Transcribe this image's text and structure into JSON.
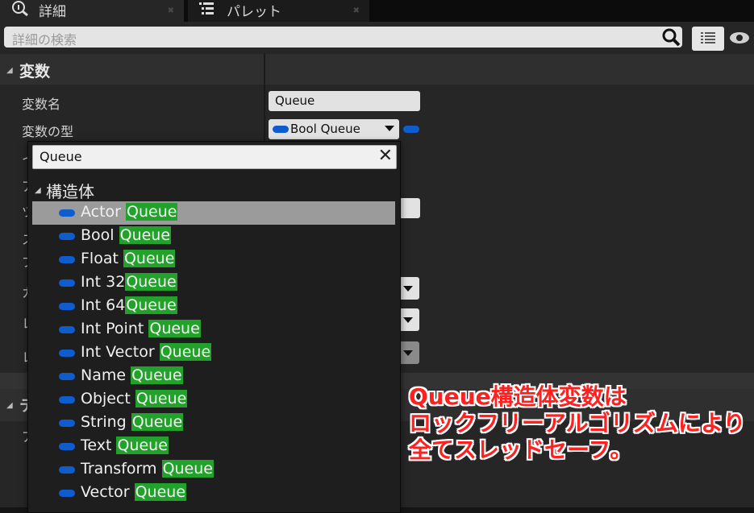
{
  "tabs": [
    {
      "label": "詳細",
      "icon": "details-icon",
      "close": "✖"
    },
    {
      "label": "パレット",
      "icon": "palette-list-icon",
      "close": "✖"
    }
  ],
  "search": {
    "placeholder": "詳細の検索",
    "icon": "search-icon"
  },
  "toolbar": {
    "view_options_icon": "grid-view-icon",
    "visibility_icon": "eye-icon"
  },
  "category": {
    "title": "変数"
  },
  "properties": {
    "name_label": "変数名",
    "name_value": "Queue",
    "type_label": "変数の型",
    "type_value": "Bool Queue"
  },
  "partial_labels": [
    "イ",
    "ア",
    "ツ",
    "ス",
    "ブ",
    "カ",
    "レ",
    "レ",
    "テ",
    "ア"
  ],
  "type_dropdown": {
    "search_value": "Queue",
    "clear_icon": "close-x-icon",
    "category": "構造体",
    "items": [
      {
        "prefix": "Actor ",
        "match": "Queue",
        "selected": true
      },
      {
        "prefix": "Bool ",
        "match": "Queue"
      },
      {
        "prefix": "Float ",
        "match": "Queue"
      },
      {
        "prefix": "Int 32",
        "match": "Queue"
      },
      {
        "prefix": "Int 64",
        "match": "Queue"
      },
      {
        "prefix": "Int Point ",
        "match": "Queue"
      },
      {
        "prefix": "Int Vector ",
        "match": "Queue"
      },
      {
        "prefix": "Name ",
        "match": "Queue"
      },
      {
        "prefix": "Object ",
        "match": "Queue"
      },
      {
        "prefix": "String ",
        "match": "Queue"
      },
      {
        "prefix": "Text ",
        "match": "Queue"
      },
      {
        "prefix": "Transform ",
        "match": "Queue"
      },
      {
        "prefix": "Vector ",
        "match": "Queue"
      }
    ]
  },
  "annotation": {
    "lines": [
      "Queue構造体変数は",
      "ロックフリーアルゴリズムにより",
      "全てスレッドセーフ。"
    ],
    "color": "#ff2020"
  },
  "colors": {
    "struct_pill": "#0f5ccf",
    "match_highlight": "#22a22a",
    "selection": "#9b9b9b"
  }
}
